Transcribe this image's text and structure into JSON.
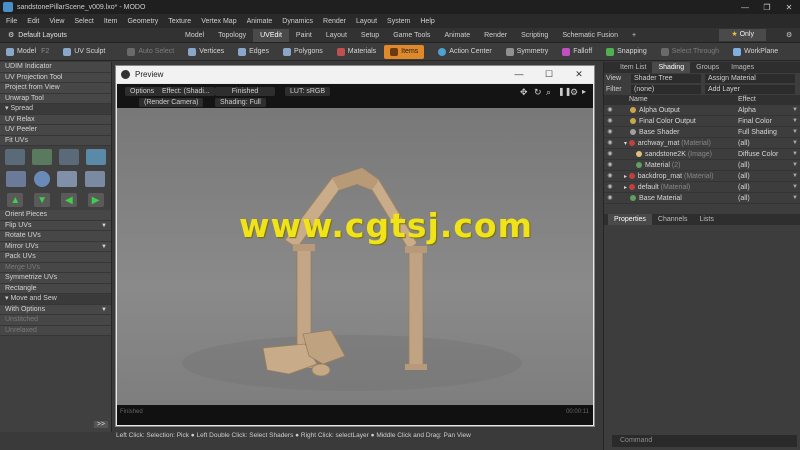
{
  "window": {
    "title": "sandstonePillarScene_v009.lxo* - MODO"
  },
  "menubar": [
    "File",
    "Edit",
    "View",
    "Select",
    "Item",
    "Geometry",
    "Texture",
    "Vertex Map",
    "Animate",
    "Dynamics",
    "Render",
    "Layout",
    "System",
    "Help"
  ],
  "layoutbar": {
    "layout_label": "Default Layouts",
    "tabs": [
      "Model",
      "Topology",
      "UVEdit",
      "Paint",
      "Layout",
      "Setup",
      "Game Tools",
      "Animate",
      "Render",
      "Scripting",
      "Schematic Fusion",
      "+"
    ],
    "active_tab": "UVEdit",
    "only_label": "Only"
  },
  "toolbar": {
    "model": "Model",
    "model_key": "F2",
    "uv_sculpt": "UV Sculpt",
    "auto_select": "Auto Select",
    "vertices": "Vertices",
    "edges": "Edges",
    "polygons": "Polygons",
    "materials": "Materials",
    "items": "Items",
    "action_center": "Action Center",
    "symmetry": "Symmetry",
    "falloff": "Falloff",
    "snapping": "Snapping",
    "select_through": "Select Through",
    "workplane": "WorkPlane"
  },
  "leftpanel": {
    "a": [
      "UDIM Indicator",
      "UV Projection Tool",
      "Project from View",
      "Unwrap Tool"
    ],
    "spread_header": "Spread",
    "b": [
      "UV Relax",
      "UV Peeler",
      "Fit UVs"
    ],
    "c": [
      "Orient Pieces",
      "Flip UVs",
      "Rotate UVs",
      "Mirror UVs",
      "Pack UVs",
      "Merge UVs",
      "Symmetrize UVs",
      "Rectangle"
    ],
    "move_header": "Move and Sew",
    "d": [
      "With Options",
      "Unstitched",
      "Unrelaxed"
    ],
    "expand": ">>"
  },
  "preview": {
    "title": "Preview",
    "options": "Options",
    "effect": "Effect: (Shadi...",
    "finished": "Finished",
    "lut": "LUT: sRGB",
    "render_camera": "(Render Camera)",
    "shading": "Shading: Full",
    "status": "Finished",
    "time": "00:00:11"
  },
  "watermark": "www.cgtsj.com",
  "rightpanel": {
    "tabs": [
      "Item List",
      "Shading",
      "Groups",
      "Images"
    ],
    "active_tab": "Shading",
    "view_label": "View",
    "view_value": "Shader Tree",
    "assign_material": "Assign Material",
    "filter_label": "Filter",
    "filter_value": "(none)",
    "add_layer": "Add Layer",
    "col_name": "Name",
    "col_effect": "Effect",
    "rows": [
      {
        "name": "Alpha Output",
        "sub": "",
        "effect": "Alpha",
        "color": "#c8a848"
      },
      {
        "name": "Final Color Output",
        "sub": "",
        "effect": "Final Color",
        "color": "#c8a848"
      },
      {
        "name": "Base Shader",
        "sub": "",
        "effect": "Full Shading",
        "color": "#a0a0a0"
      },
      {
        "name": "archway_mat",
        "sub": "(Material)",
        "effect": "(all)",
        "color": "#c04040"
      },
      {
        "name": "sandstone2K",
        "sub": "(Image)",
        "effect": "Diffuse Color",
        "color": "#e0c080"
      },
      {
        "name": "Material",
        "sub": "(2)",
        "effect": "(all)",
        "color": "#60a060"
      },
      {
        "name": "backdrop_mat",
        "sub": "(Material)",
        "effect": "(all)",
        "color": "#c04040"
      },
      {
        "name": "default",
        "sub": "(Material)",
        "effect": "(all)",
        "color": "#c04040"
      },
      {
        "name": "Base Material",
        "sub": "",
        "effect": "(all)",
        "color": "#60a060"
      }
    ],
    "bottom_tabs": [
      "Properties",
      "Channels",
      "Lists"
    ]
  },
  "command_placeholder": "Command",
  "statusbar": "Left Click: Selection: Pick ● Left Double Click: Select Shaders ● Right Click: selectLayer ● Middle Click and Drag: Pan View"
}
